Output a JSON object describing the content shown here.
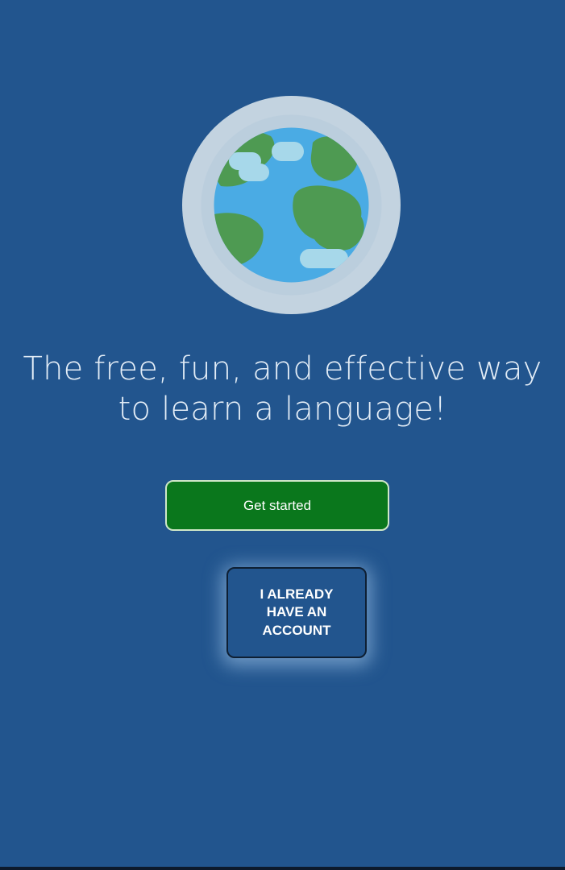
{
  "welcome": {
    "globe_icon": "earth-globe-icon",
    "tagline": "The free, fun, and effective way to learn a language!",
    "get_started_label": "Get started",
    "existing_account_label": "I ALREADY HAVE AN ACCOUNT"
  },
  "colors": {
    "background": "#22558E",
    "primary_button": "#0A771C",
    "primary_button_border": "#CFE7C8",
    "text_light": "#E3EDF7",
    "globe_ocean": "#4AABE4",
    "globe_land": "#4E9A52",
    "globe_ring": "#C3D3E0"
  }
}
